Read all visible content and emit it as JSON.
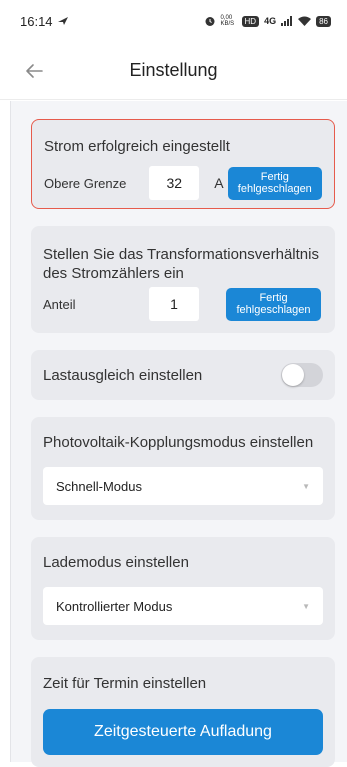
{
  "status_bar": {
    "time": "16:14",
    "net_speed": "0,00 KB/S",
    "network": "4G",
    "battery": "86"
  },
  "header": {
    "title": "Einstellung"
  },
  "current": {
    "title": "Strom erfolgreich eingestellt",
    "label": "Obere Grenze",
    "value": "32",
    "unit": "A",
    "button_line1": "Fertig",
    "button_line2": "fehlgeschlagen"
  },
  "ratio": {
    "title": "Stellen Sie das Transformationsverhältnis des Stromzählers ein",
    "label": "Anteil",
    "value": "1",
    "button_line1": "Fertig",
    "button_line2": "fehlgeschlagen"
  },
  "load_balance": {
    "label": "Lastausgleich einstellen",
    "enabled": false
  },
  "pv": {
    "title": "Photovoltaik-Kopplungsmodus einstellen",
    "selected": "Schnell-Modus"
  },
  "charge_mode": {
    "title": "Lademodus einstellen",
    "selected": "Kontrollierter Modus"
  },
  "schedule": {
    "title": "Zeit für Termin einstellen",
    "button": "Zeitgesteuerte Aufladung"
  },
  "colors": {
    "accent": "#1b87d6",
    "highlight_border": "#e65b4c",
    "card_bg": "#e9eaee"
  },
  "icons": {
    "back": "arrow-left-icon",
    "dropdown": "caret-down-icon"
  }
}
